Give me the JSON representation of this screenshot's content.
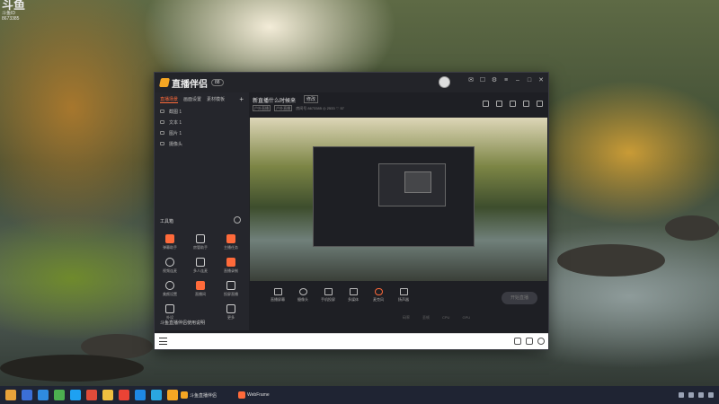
{
  "watermark": {
    "logo": "斗鱼",
    "sub": "斗鱼ID",
    "room_id": "8673385"
  },
  "window": {
    "app_name": "直播伴侣",
    "version_badge": "88",
    "tabs": [
      {
        "label": "直播场景"
      },
      {
        "label": "画面设置"
      },
      {
        "label": "素材模板"
      }
    ],
    "scenes": [
      {
        "label": "截图 1"
      },
      {
        "label": "文本 1"
      },
      {
        "label": "图片 1"
      },
      {
        "label": "摄像头"
      }
    ],
    "tools_header": "工具箱",
    "tools": [
      {
        "label": "弹幕助手",
        "color": "#ff6a3a"
      },
      {
        "label": "房管助手",
        "color": "#cfcfcf"
      },
      {
        "label": "主播任务",
        "color": "#ff6a3a"
      },
      {
        "label": "视频连麦",
        "color": "#cfcfcf"
      },
      {
        "label": "多人连麦",
        "color": "#cfcfcf"
      },
      {
        "label": "直播录制",
        "color": "#ff6a3a"
      },
      {
        "label": "美颜设置",
        "color": "#cfcfcf"
      },
      {
        "label": "直播间",
        "color": "#ff6a3a"
      },
      {
        "label": "投屏直播",
        "color": "#cfcfcf"
      },
      {
        "label": "外设",
        "color": "#cfcfcf"
      },
      {
        "label": "更多",
        "color": "#cfcfcf"
      }
    ],
    "notice": "斗鱼直播伴侣使用说明",
    "header": {
      "title": "新直播什么时候来",
      "badge": "修改",
      "tag1": "户外直播",
      "tag2": "户外直播",
      "room_label": "房间号",
      "room_id": "8673385",
      "viewers": "2533",
      "fans": "57"
    },
    "toolbar": [
      {
        "label": "直播屏幕"
      },
      {
        "label": "摄像头"
      },
      {
        "label": "手机投屏"
      },
      {
        "label": "多媒体"
      },
      {
        "label": "麦克风"
      },
      {
        "label": "扬声器"
      }
    ],
    "go_live": "开始直播",
    "stats": [
      "码率",
      "丢帧",
      "CPU",
      "GPU"
    ]
  },
  "taskbar": {
    "apps": [
      {
        "label": "斗鱼直播伴侣"
      },
      {
        "label": "WebFrame"
      }
    ]
  },
  "colors": {
    "accent": "#ff6a3a",
    "panel": "#25262c",
    "taskbar": "#1f2433"
  }
}
